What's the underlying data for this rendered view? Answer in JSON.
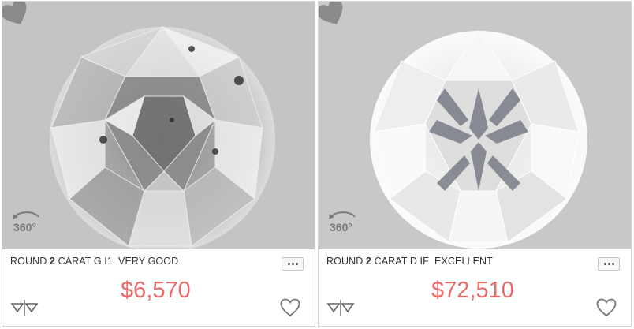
{
  "listings": [
    {
      "shape": "ROUND",
      "carat_value": "2",
      "carat_unit": "CARAT",
      "color_clarity": "G I1",
      "cut": "VERY GOOD",
      "price": "$6,570",
      "badge_360": "360°"
    },
    {
      "shape": "ROUND",
      "carat_value": "2",
      "carat_unit": "CARAT",
      "color_clarity": "D IF",
      "cut": "EXCELLENT",
      "price": "$72,510",
      "badge_360": "360°"
    }
  ],
  "colors": {
    "price": "#ea6a6a",
    "photo_bg": "#c4c4c4",
    "border": "#d4d4d4"
  },
  "icons": {
    "spin": "rotate-360-icon",
    "more": "more-options-icon",
    "compare": "compare-icon",
    "favorite": "heart-icon"
  }
}
